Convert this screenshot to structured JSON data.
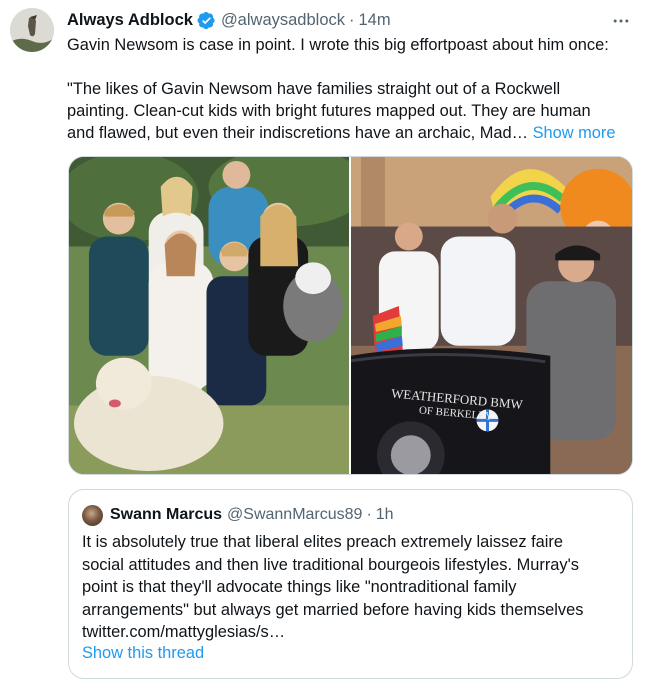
{
  "tweet": {
    "display_name": "Always Adblock",
    "handle": "@alwaysadblock",
    "separator": "·",
    "time": "14m",
    "text_lines": [
      "Gavin Newsom is case in point. I wrote this big effortpoast about him once:",
      "",
      "\"The likes of Gavin Newsom have families straight out of a Rockwell",
      "painting. Clean-cut kids with bright futures mapped out. They are human",
      "and flawed, but even their indiscretions have an archaic, Mad…"
    ],
    "show_more": "Show more",
    "photo_right_sign_line1": "WEATHERFORD BMW",
    "photo_right_sign_line2": "OF BERKELEY"
  },
  "quote": {
    "display_name": "Swann Marcus",
    "handle": "@SwannMarcus89",
    "separator": "·",
    "time": "1h",
    "text_lines": [
      "It is absolutely true that liberal elites preach extremely laissez faire",
      "social attitudes and then live traditional bourgeois lifestyles.  Murray's",
      "point is that they'll advocate things like \"nontraditional family",
      "arrangements\" but always get married before having kids themselves",
      "twitter.com/mattyglesias/s…"
    ],
    "show_thread": "Show this thread"
  },
  "colors": {
    "text": "#0f1419",
    "secondary": "#536471",
    "link": "#1d9bf0",
    "border": "#cfd9de"
  },
  "icons": {
    "verified": "verified-badge-icon",
    "more": "more-options-icon"
  }
}
